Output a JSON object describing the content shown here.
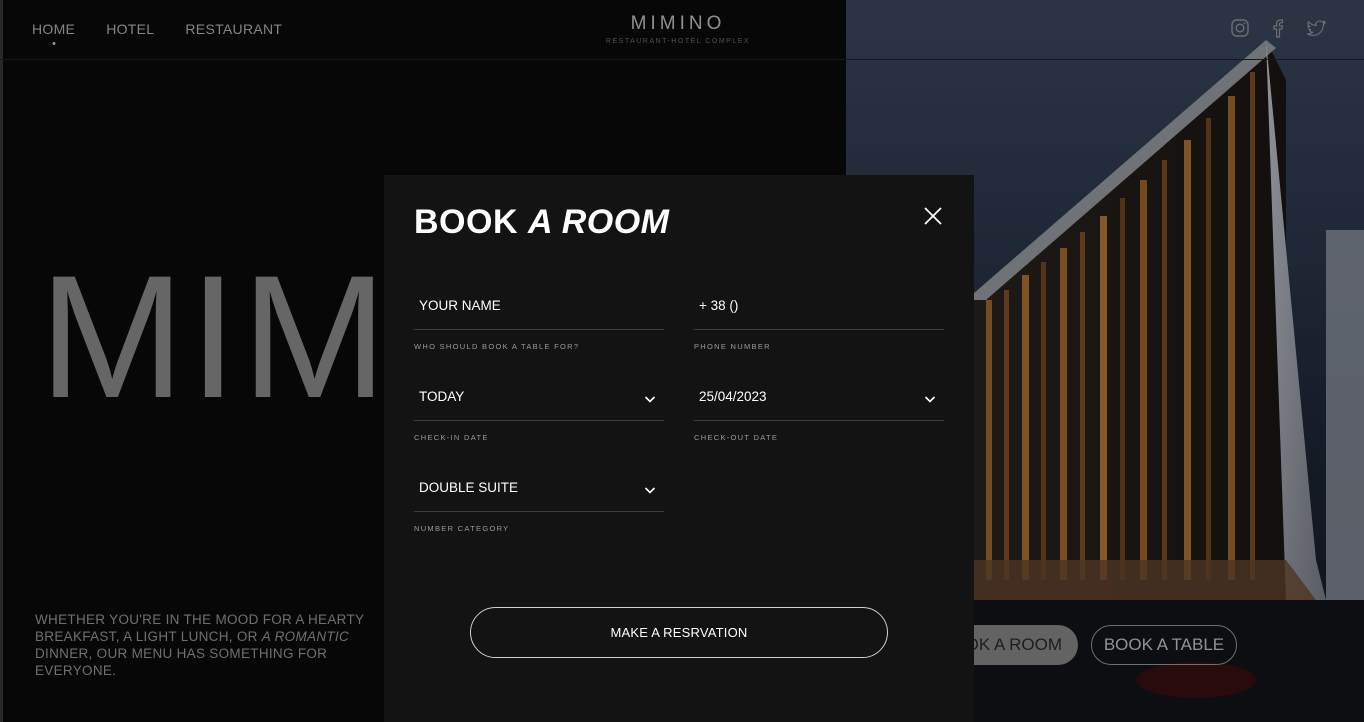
{
  "nav": {
    "items": [
      {
        "label": "HOME",
        "active": true
      },
      {
        "label": "HOTEL",
        "active": false
      },
      {
        "label": "RESTAURANT",
        "active": false
      }
    ]
  },
  "brand": {
    "name": "MIMINO",
    "subtitle": "RESTAURANT-HOTEL COMPLEX"
  },
  "socials": [
    "instagram-icon",
    "facebook-icon",
    "twitter-icon"
  ],
  "hero": {
    "big_word": "MIMI",
    "desc_part1": "WHETHER YOU'RE IN THE MOOD FOR A HEARTY BREAKFAST, A LIGHT LUNCH, OR ",
    "desc_emph": "A ROMANTIC",
    "desc_part2": " DINNER, OUR MENU HAS SOMETHING FOR EVERYONE."
  },
  "cta": {
    "book_room": "OK A ROOM",
    "book_table": "BOOK A TABLE"
  },
  "modal": {
    "title_plain": "BOOK ",
    "title_emph": "A ROOM",
    "fields": {
      "name": {
        "placeholder": "YOUR NAME",
        "hint": "WHO SHOULD BOOK A TABLE FOR?"
      },
      "phone": {
        "placeholder": "+ 38 ()",
        "hint": "PHONE NUMBER"
      },
      "checkin": {
        "value": "TODAY",
        "hint": "CHECK-IN DATE"
      },
      "checkout": {
        "value": "25/04/2023",
        "hint": "CHECK-OUT DATE"
      },
      "category": {
        "value": "DOUBLE SUITE",
        "hint": "NUMBER CATEGORY"
      }
    },
    "submit_label": "MAKE A RESRVATION"
  }
}
